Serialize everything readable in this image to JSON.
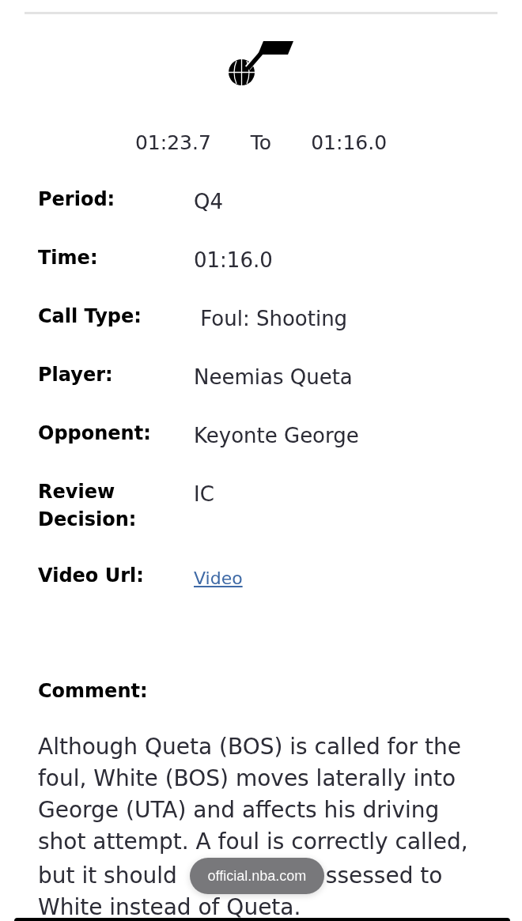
{
  "header": {
    "times": {
      "start": "01:23.7",
      "separator": "To",
      "end": "01:16.0"
    }
  },
  "details": [
    {
      "label": "Period:",
      "value": "Q4",
      "kind": "text"
    },
    {
      "label": "Time:",
      "value": "01:16.0",
      "kind": "text"
    },
    {
      "label": "Call Type:",
      "value": " Foul: Shooting",
      "kind": "text"
    },
    {
      "label": "Player:",
      "value": "Neemias Queta",
      "kind": "text"
    },
    {
      "label": "Opponent:",
      "value": "Keyonte George",
      "kind": "text"
    },
    {
      "label": "Review Decision:",
      "value": "IC",
      "kind": "text"
    },
    {
      "label": "Video Url:",
      "value": "Video",
      "kind": "link"
    }
  ],
  "comment": {
    "label": "Comment:",
    "text_above_overlay": "Although Queta (BOS) is called for the foul, White (BOS) moves laterally into George (UTA) and affects his driving shot attempt. A foul is correctly called,",
    "overlay_line_left": "but it should",
    "overlay_line_right": "ssessed to",
    "text_below_overlay": "White instead of Queta."
  },
  "browser": {
    "address": "official.nba.com"
  }
}
